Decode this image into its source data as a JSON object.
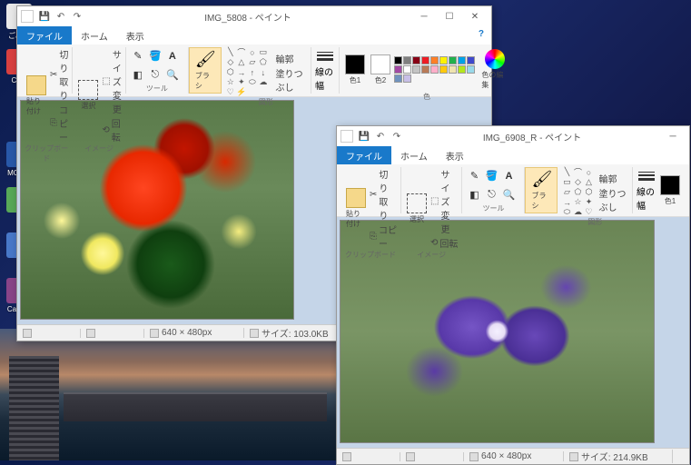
{
  "desktop": {
    "icons": [
      {
        "label": "ごみ箱",
        "color": "#e8e8e8"
      },
      {
        "label": "Cam",
        "color": "#d84040"
      },
      {
        "label": "MOVIE",
        "color": "#2858a8"
      },
      {
        "label": "",
        "color": "#58a858"
      },
      {
        "label": "",
        "color": "#4878c8"
      },
      {
        "label": "Card M",
        "color": "#884488"
      }
    ]
  },
  "window1": {
    "title": "IMG_5808 - ペイント",
    "tabs": {
      "file": "ファイル",
      "home": "ホーム",
      "view": "表示"
    },
    "help": "?",
    "ribbon": {
      "clipboard": {
        "paste": "貼り付け",
        "cut": "切り取り",
        "copy": "コピー",
        "label": "クリップボード"
      },
      "image": {
        "select": "選択",
        "resize": "サイズ変更",
        "rotate": "回転",
        "label": "イメージ"
      },
      "tools": {
        "label": "ツール"
      },
      "brushes": {
        "btn": "ブラシ"
      },
      "shapes": {
        "outline": "輪郭",
        "fill": "塗りつぶし",
        "label": "図形"
      },
      "stroke": {
        "label": "線の幅"
      },
      "colors": {
        "c1": "色1",
        "c2": "色2",
        "edit": "色の編集",
        "label": "色"
      }
    },
    "status": {
      "pos": "",
      "dim": "640 × 480px",
      "size": "サイズ: 103.0KB"
    }
  },
  "window2": {
    "title": "IMG_6908_R - ペイント",
    "tabs": {
      "file": "ファイル",
      "home": "ホーム",
      "view": "表示"
    },
    "help": "?",
    "ribbon": {
      "clipboard": {
        "paste": "貼り付け",
        "cut": "切り取り",
        "copy": "コピー",
        "label": "クリップボード"
      },
      "image": {
        "select": "選択",
        "resize": "サイズ変更",
        "rotate": "回転",
        "label": "イメージ"
      },
      "tools": {
        "label": "ツール"
      },
      "brushes": {
        "btn": "ブラシ"
      },
      "shapes": {
        "outline": "輪郭",
        "fill": "塗りつぶし",
        "label": "図形"
      },
      "stroke": {
        "label": "線の幅"
      },
      "colors": {
        "c1": "色1"
      }
    },
    "status": {
      "pos": "",
      "dim": "640 × 480px",
      "size": "サイズ: 214.9KB"
    }
  },
  "palette": [
    "#000",
    "#7f7f7f",
    "#880015",
    "#ed1c24",
    "#ff7f27",
    "#fff200",
    "#22b14c",
    "#00a2e8",
    "#3f48cc",
    "#a349a4",
    "#fff",
    "#c3c3c3",
    "#b97a57",
    "#ffaec9",
    "#ffc90e",
    "#efe4b0",
    "#b5e61d",
    "#99d9ea",
    "#7092be",
    "#c8bfe7"
  ]
}
